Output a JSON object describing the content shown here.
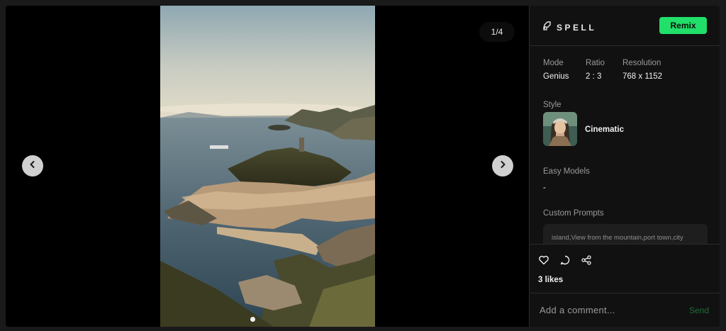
{
  "viewer": {
    "counter": "1/4",
    "prev_icon": "chevron-left-icon",
    "next_icon": "chevron-right-icon",
    "current_slide": 1,
    "total_slides": 4
  },
  "panel": {
    "brand": "SPELL",
    "remix_label": "Remix",
    "meta": [
      {
        "label": "Mode",
        "value": "Genius"
      },
      {
        "label": "Ratio",
        "value": "2 : 3"
      },
      {
        "label": "Resolution",
        "value": "768 x 1152"
      }
    ],
    "style_label": "Style",
    "style_name": "Cinematic",
    "easy_models_label": "Easy Models",
    "easy_models_value": "-",
    "custom_prompts_label": "Custom Prompts",
    "custom_prompts_value": "island,View from the mountain,port town,city",
    "likes": "3 likes",
    "comment_placeholder": "Add a comment...",
    "send_label": "Send"
  },
  "colors": {
    "accent": "#20e06a",
    "panel_bg": "#111111",
    "viewer_bg": "#000000"
  }
}
